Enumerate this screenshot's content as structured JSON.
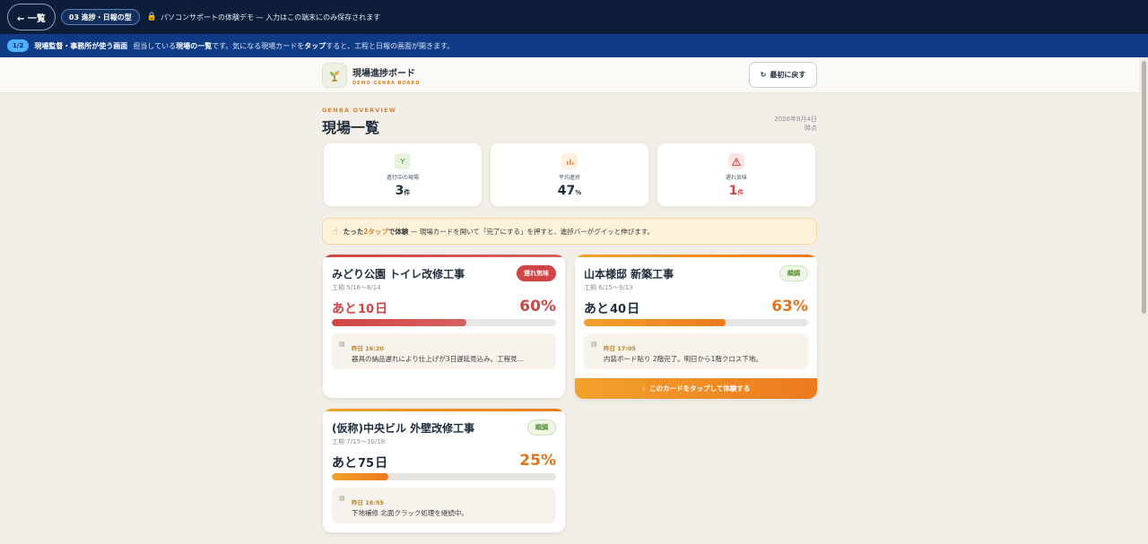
{
  "topbar": {
    "back_label": "← 一覧",
    "chapter": "03 進捗・日報の型",
    "demo_note": "パソコンサポートの体験デモ — 入力はこの端末にのみ保存されます"
  },
  "guidebar": {
    "step": "1/2",
    "role": "現場監督・事務所が使う画面",
    "text_1": "担当している",
    "text_bold_1": "現場の一覧",
    "text_2": "です。気になる現場カードを",
    "text_bold_2": "タップ",
    "text_3": "すると、工程と日報の画面が開きます。"
  },
  "app": {
    "brand_title": "現場進捗ボード",
    "brand_subtitle": "DEMO GENBA BOARD",
    "reset_label": "最初に戻す"
  },
  "overview": {
    "eyebrow": "GENBA OVERVIEW",
    "title": "現場一覧",
    "date": "2026年8月4日",
    "date_suffix": "時点"
  },
  "stats": [
    {
      "icon": "Y",
      "label": "進行中の現場",
      "value": "3",
      "unit": "件",
      "color": "#1f2d3d",
      "icon_bg": "#e8f3df",
      "icon_color": "#4a8a2a"
    },
    {
      "icon": "bar-chart-icon",
      "label": "平均進捗",
      "value": "47",
      "unit": "%",
      "color": "#1f2d3d",
      "icon_bg": "#fdeede",
      "icon_color": "#e3933a"
    },
    {
      "icon": "warning-icon",
      "label": "遅れ気味",
      "value": "1",
      "unit": "件",
      "color": "#d04545",
      "icon_bg": "#fbe4e2",
      "icon_color": "#d04545"
    }
  ],
  "tip": {
    "prefix": "たった",
    "em": "2タップ",
    "bold": "で体験",
    "text": " — 現場カードを開いて「完了にする」を押すと、進捗バーがグイッと伸びます。"
  },
  "sites": [
    {
      "name": "みどり公園 トイレ改修工事",
      "period": "工期 5/16〜8/14",
      "status": "遅れ気味",
      "remain_prefix": "あと",
      "remain_days": "10",
      "remain_suffix": "日",
      "progress": 60,
      "progress_label": "60%",
      "report_time": "昨日 16:20",
      "report_text": "器具の納品遅れにより仕上げが3日遅延見込み。工程見…",
      "accent": "#d04545"
    },
    {
      "name": "山本様邸 新築工事",
      "period": "工期 6/15〜9/13",
      "status": "順調",
      "remain_prefix": "あと",
      "remain_days": "40",
      "remain_suffix": "日",
      "progress": 63,
      "progress_label": "63%",
      "report_time": "昨日 17:05",
      "report_text": "内装ボード貼り 2階完了。明日から1階クロス下地。",
      "cta": "このカードをタップして体験する",
      "accent": "#ec8a23"
    },
    {
      "name": "(仮称)中央ビル 外壁改修工事",
      "period": "工期 7/15〜10/18",
      "status": "順調",
      "remain_prefix": "あと",
      "remain_days": "75",
      "remain_suffix": "日",
      "progress": 25,
      "progress_label": "25%",
      "report_time": "昨日 16:55",
      "report_text": "下地補修 北面クラック処理を継続中。",
      "accent": "#ec8a23"
    }
  ]
}
